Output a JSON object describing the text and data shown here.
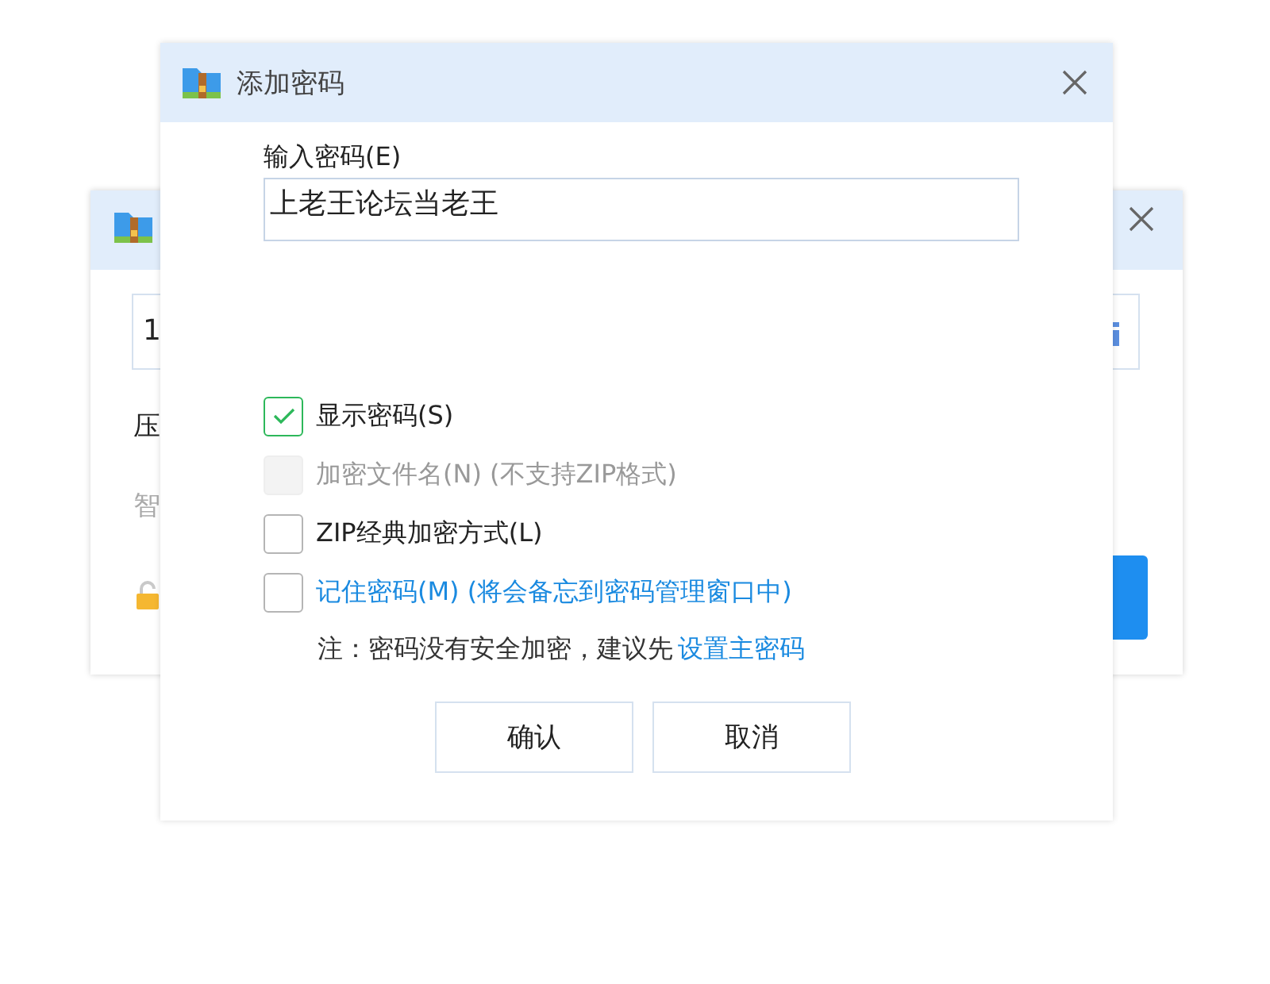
{
  "background_window": {
    "field_value": "1",
    "row_1": "压",
    "row_2": "智"
  },
  "dialog": {
    "title": "添加密码",
    "password_label": "输入密码(E)",
    "password_value": "上老王论坛当老王",
    "options": [
      {
        "label": "显示密码(S)",
        "checked": true,
        "disabled": false,
        "kind": "plain"
      },
      {
        "label": "加密文件名(N) (不支持ZIP格式)",
        "checked": false,
        "disabled": true,
        "kind": "plain"
      },
      {
        "label": "ZIP经典加密方式(L)",
        "checked": false,
        "disabled": false,
        "kind": "plain"
      },
      {
        "label": "记住密码(M) (将会备忘到密码管理窗口中)",
        "checked": false,
        "disabled": false,
        "kind": "link"
      }
    ],
    "note": "注：密码没有安全加密，建议先",
    "note_link": "设置主密码",
    "buttons": [
      "确认",
      "取消"
    ]
  }
}
